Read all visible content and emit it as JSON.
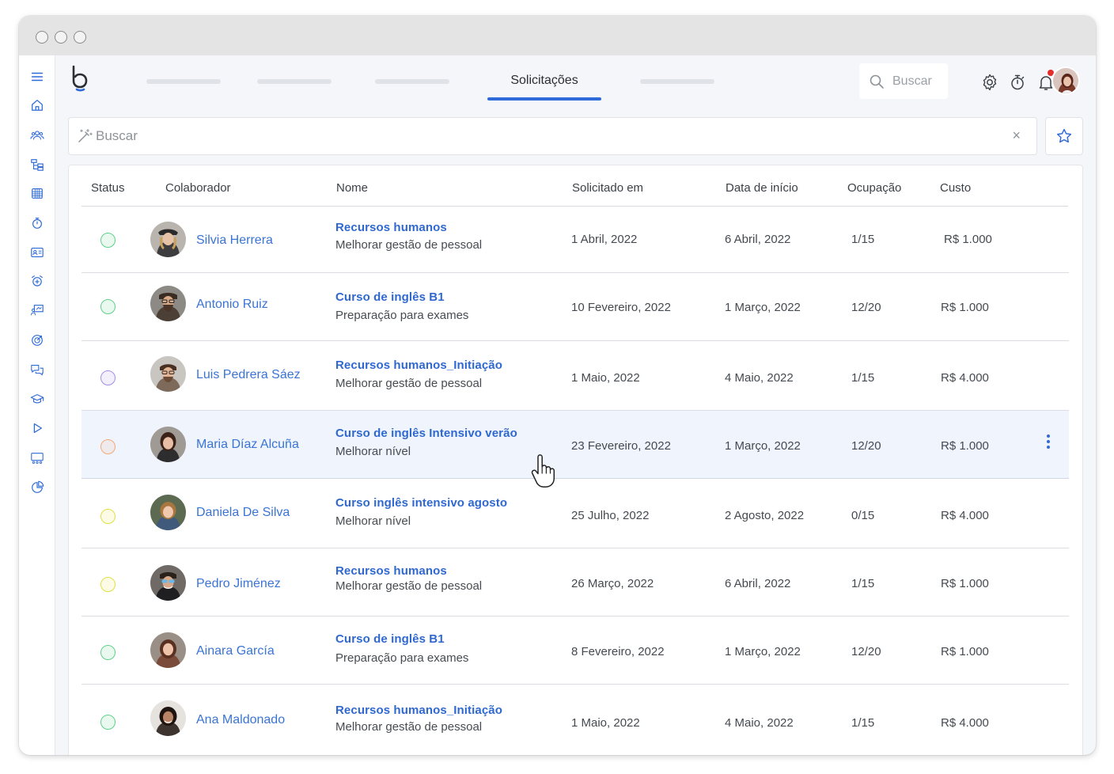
{
  "nav": {
    "active_tab": "Solicitações",
    "search_placeholder": "Buscar"
  },
  "filter": {
    "search_placeholder": "Buscar",
    "clear_glyph": "×"
  },
  "colors": {
    "accent": "#2f6bd8",
    "status_green": "#5fd08a",
    "status_purple": "#a28ee6",
    "status_orange": "#f2a97a",
    "status_yellow": "#dfe040",
    "notification": "#e62b2b"
  },
  "sidebar_icons": [
    "menu-icon",
    "home-icon",
    "people-icon",
    "org-chart-icon",
    "calendar-icon",
    "timer-icon",
    "id-card-icon",
    "alarm-icon",
    "presentation-icon",
    "target-icon",
    "chat-icon",
    "graduation-cap-icon",
    "play-icon",
    "board-icon",
    "pie-chart-icon"
  ],
  "table": {
    "headers": [
      "Status",
      "Colaborador",
      "Nome",
      "Solicitado em",
      "Data de início",
      "Ocupação",
      "Custo"
    ],
    "rows": [
      {
        "status": "green",
        "name": "Silvia Herrera",
        "course": "Recursos humanos",
        "course_sub": "Melhorar gestão de pessoal",
        "requested": "1 Abril, 2022",
        "start": "6 Abril, 2022",
        "occupancy": "1/15",
        "cost": "R$ 1.000"
      },
      {
        "status": "green",
        "name": "Antonio Ruiz",
        "course": "Curso de inglês B1",
        "course_sub": "Preparação para exames",
        "requested": "10 Fevereiro, 2022",
        "start": "1 Março, 2022",
        "occupancy": "12/20",
        "cost": "R$ 1.000"
      },
      {
        "status": "purple",
        "name": "Luis Pedrera Sáez",
        "course": "Recursos humanos_Initiação",
        "course_sub": "Melhorar gestão de pessoal",
        "requested": "1 Maio, 2022",
        "start": "4 Maio, 2022",
        "occupancy": "1/15",
        "cost": "R$ 4.000"
      },
      {
        "status": "orange",
        "name": "Maria Díaz Alcuña",
        "course": "Curso de inglês Intensivo verão",
        "course_sub": "Melhorar nível",
        "requested": "23 Fevereiro, 2022",
        "start": "1 Março, 2022",
        "occupancy": "12/20",
        "cost": "R$ 1.000"
      },
      {
        "status": "yellow",
        "name": "Daniela De Silva",
        "course": "Curso inglês intensivo agosto",
        "course_sub": "Melhorar nível",
        "requested": "25 Julho, 2022",
        "start": "2 Agosto, 2022",
        "occupancy": "0/15",
        "cost": "R$ 4.000"
      },
      {
        "status": "yellow",
        "name": "Pedro Jiménez",
        "course": "Recursos humanos",
        "course_sub": "Melhorar gestão de pessoal",
        "requested": "26 Março, 2022",
        "start": "6 Abril, 2022",
        "occupancy": "1/15",
        "cost": "R$ 1.000"
      },
      {
        "status": "green",
        "name": "Ainara García",
        "course": "Curso de inglês B1",
        "course_sub": "Preparação para exames",
        "requested": "8 Fevereiro, 2022",
        "start": "1 Março, 2022",
        "occupancy": "12/20",
        "cost": "R$ 1.000"
      },
      {
        "status": "green",
        "name": "Ana Maldonado",
        "course": "Recursos humanos_Initiação",
        "course_sub": "Melhorar gestão de pessoal",
        "requested": "1 Maio, 2022",
        "start": "4 Maio, 2022",
        "occupancy": "1/15",
        "cost": "R$ 4.000"
      }
    ]
  }
}
